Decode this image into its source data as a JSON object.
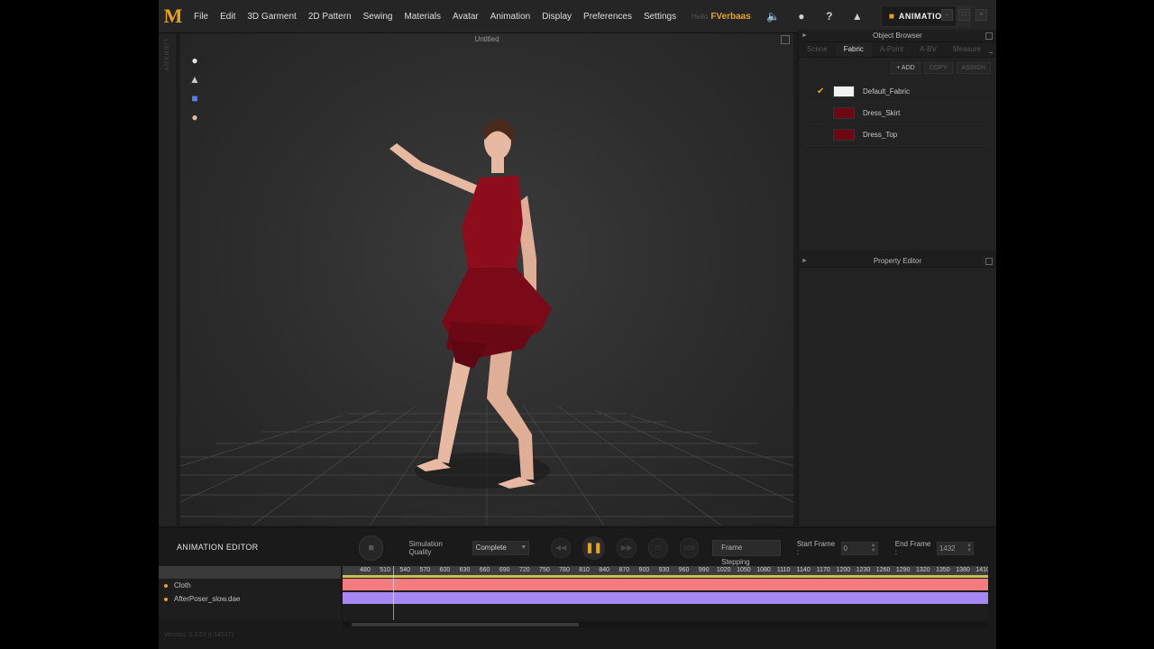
{
  "app": {
    "logo": "M"
  },
  "menu": [
    "File",
    "Edit",
    "3D Garment",
    "2D Pattern",
    "Sewing",
    "Materials",
    "Avatar",
    "Animation",
    "Display",
    "Preferences",
    "Settings"
  ],
  "user": {
    "hello": "Hello",
    "name": "FVerbaas"
  },
  "mode": {
    "label": "ANIMATION"
  },
  "icons": {
    "volume": "volume-icon",
    "user": "user-icon",
    "help": "help-icon",
    "garment": "garment-icon"
  },
  "viewport": {
    "title": "Untitled"
  },
  "library": {
    "label": "LIBRARY"
  },
  "object_browser": {
    "title": "Object Browser",
    "tabs": [
      "Scene",
      "Fabric",
      "A-Point",
      "A-BV",
      "Measure"
    ],
    "active_tab": "Fabric",
    "actions": {
      "add": "ADD",
      "copy": "COPY",
      "assign": "ASSIGN"
    },
    "fabrics": [
      {
        "name": "Default_Fabric",
        "color": "#f2f2f2",
        "selected": true
      },
      {
        "name": "Dress_Skirt",
        "color": "#6e0614",
        "selected": false
      },
      {
        "name": "Dress_Top",
        "color": "#6e0614",
        "selected": false
      }
    ]
  },
  "property_editor": {
    "title": "Property Editor"
  },
  "animation_editor": {
    "title": "ANIMATION EDITOR",
    "sim_quality_label": "Simulation Quality",
    "sim_quality_value": "Complete",
    "frame_stepping": "Frame Stepping",
    "speed": "1/2X",
    "start_frame_label": "Start Frame :",
    "start_frame": "0",
    "end_frame_label": "End Frame :",
    "end_frame": "1432",
    "tracks": [
      {
        "name": "Cloth",
        "color": "#f47c80"
      },
      {
        "name": "AfterPoser_slow.dae",
        "color": "#a688f2"
      }
    ],
    "ruler_ticks": [
      "480",
      "510",
      "540",
      "570",
      "600",
      "630",
      "660",
      "690",
      "720",
      "750",
      "780",
      "810",
      "840",
      "870",
      "900",
      "930",
      "960",
      "990",
      "1020",
      "1050",
      "1080",
      "1110",
      "1140",
      "1170",
      "1200",
      "1230",
      "1260",
      "1290",
      "1320",
      "1350",
      "1380",
      "1410"
    ]
  },
  "version": "Version: 2.3.53    (r:14537)",
  "colors": {
    "accent": "#e8a21c",
    "dress": "#8e0d1d",
    "skin": "#e8b9a2"
  }
}
